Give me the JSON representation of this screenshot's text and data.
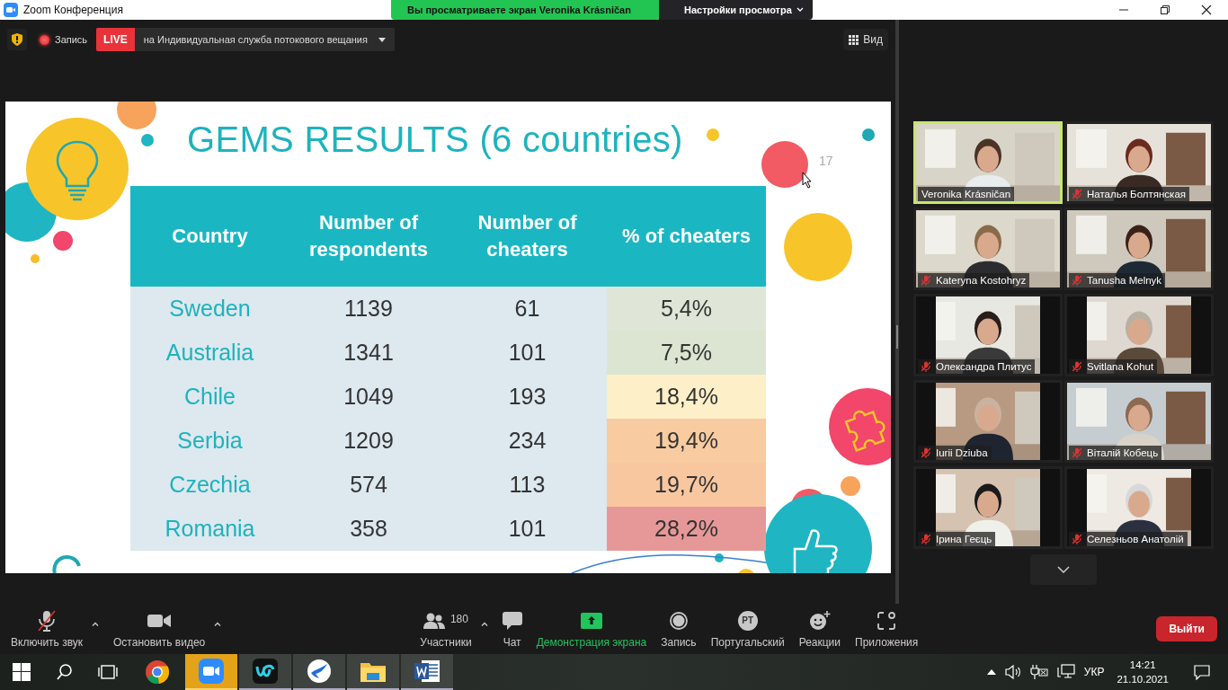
{
  "window": {
    "title": "Zoom Конференция"
  },
  "share_banner": {
    "text": "Вы просматриваете экран Veronika Krásničan",
    "settings": "Настройки просмотра"
  },
  "meeting_bar": {
    "recording_label": "Запись",
    "live_badge": "LIVE",
    "stream_target": "на Индивидуальная служба потокового вещания",
    "view_button": "Вид"
  },
  "slide": {
    "title": "GEMS RESULTS (6 countries)",
    "page_number": "17",
    "table": {
      "columns": [
        "Country",
        "Number of respondents",
        "Number of cheaters",
        "% of cheaters"
      ],
      "rows": [
        {
          "cells": [
            "Sweden",
            "1139",
            "61",
            "5,4%"
          ],
          "color": "#dfe6d8"
        },
        {
          "cells": [
            "Australia",
            "1341",
            "101",
            "7,5%"
          ],
          "color": "#dbe5d1"
        },
        {
          "cells": [
            "Chile",
            "1049",
            "193",
            "18,4%"
          ],
          "color": "#fdefc8"
        },
        {
          "cells": [
            "Serbia",
            "1209",
            "234",
            "19,4%"
          ],
          "color": "#f8cba0"
        },
        {
          "cells": [
            "Czechia",
            "574",
            "113",
            "19,7%"
          ],
          "color": "#f8c7a0"
        },
        {
          "cells": [
            "Romania",
            "358",
            "101",
            "28,2%"
          ],
          "color": "#e69899"
        }
      ]
    }
  },
  "participants": [
    {
      "name": "Veronika Krásničan",
      "muted": false,
      "speaking": true
    },
    {
      "name": "Наталья Болтянская",
      "muted": true,
      "speaking": false
    },
    {
      "name": "Kateryna Kostohryz",
      "muted": true,
      "speaking": false
    },
    {
      "name": "Tanusha Melnyk",
      "muted": true,
      "speaking": false
    },
    {
      "name": "Олександра Плитус",
      "muted": true,
      "speaking": false
    },
    {
      "name": "Svitlana Kohut",
      "muted": true,
      "speaking": false
    },
    {
      "name": "Iurii Dziuba",
      "muted": true,
      "speaking": false
    },
    {
      "name": "Віталій Кобець",
      "muted": true,
      "speaking": false
    },
    {
      "name": "Ірина Геєць",
      "muted": true,
      "speaking": false
    },
    {
      "name": "Селезньов Анатолій",
      "muted": true,
      "speaking": false
    }
  ],
  "toolbar": {
    "items": [
      {
        "kind": "mic",
        "label": "Включить звук",
        "muted": true,
        "menu": true
      },
      {
        "kind": "video",
        "label": "Остановить видео",
        "menu": true
      },
      {
        "kind": "participants",
        "label": "Участники",
        "count": "180",
        "menu": true
      },
      {
        "kind": "chat",
        "label": "Чат",
        "menu": false
      },
      {
        "kind": "share",
        "label": "Демонстрация экрана",
        "menu": false
      },
      {
        "kind": "record",
        "label": "Запись",
        "menu": false
      },
      {
        "kind": "avatar",
        "label": "Португальский",
        "initials": "PT",
        "menu": false
      },
      {
        "kind": "reactions",
        "label": "Реакции",
        "menu": false
      },
      {
        "kind": "apps",
        "label": "Приложения",
        "menu": false
      }
    ],
    "leave_button": "Выйти"
  },
  "taskbar": {
    "apps": [
      {
        "kind": "chrome",
        "open": false,
        "flashing": false
      },
      {
        "kind": "zoom",
        "open": true,
        "flashing": true
      },
      {
        "kind": "webex",
        "open": true,
        "flashing": false
      },
      {
        "kind": "bird",
        "open": true,
        "flashing": false
      },
      {
        "kind": "explorer",
        "open": true,
        "flashing": false
      },
      {
        "kind": "word",
        "open": true,
        "flashing": false
      }
    ],
    "language": "УКР",
    "time": "14:21",
    "date": "21.10.2021"
  }
}
